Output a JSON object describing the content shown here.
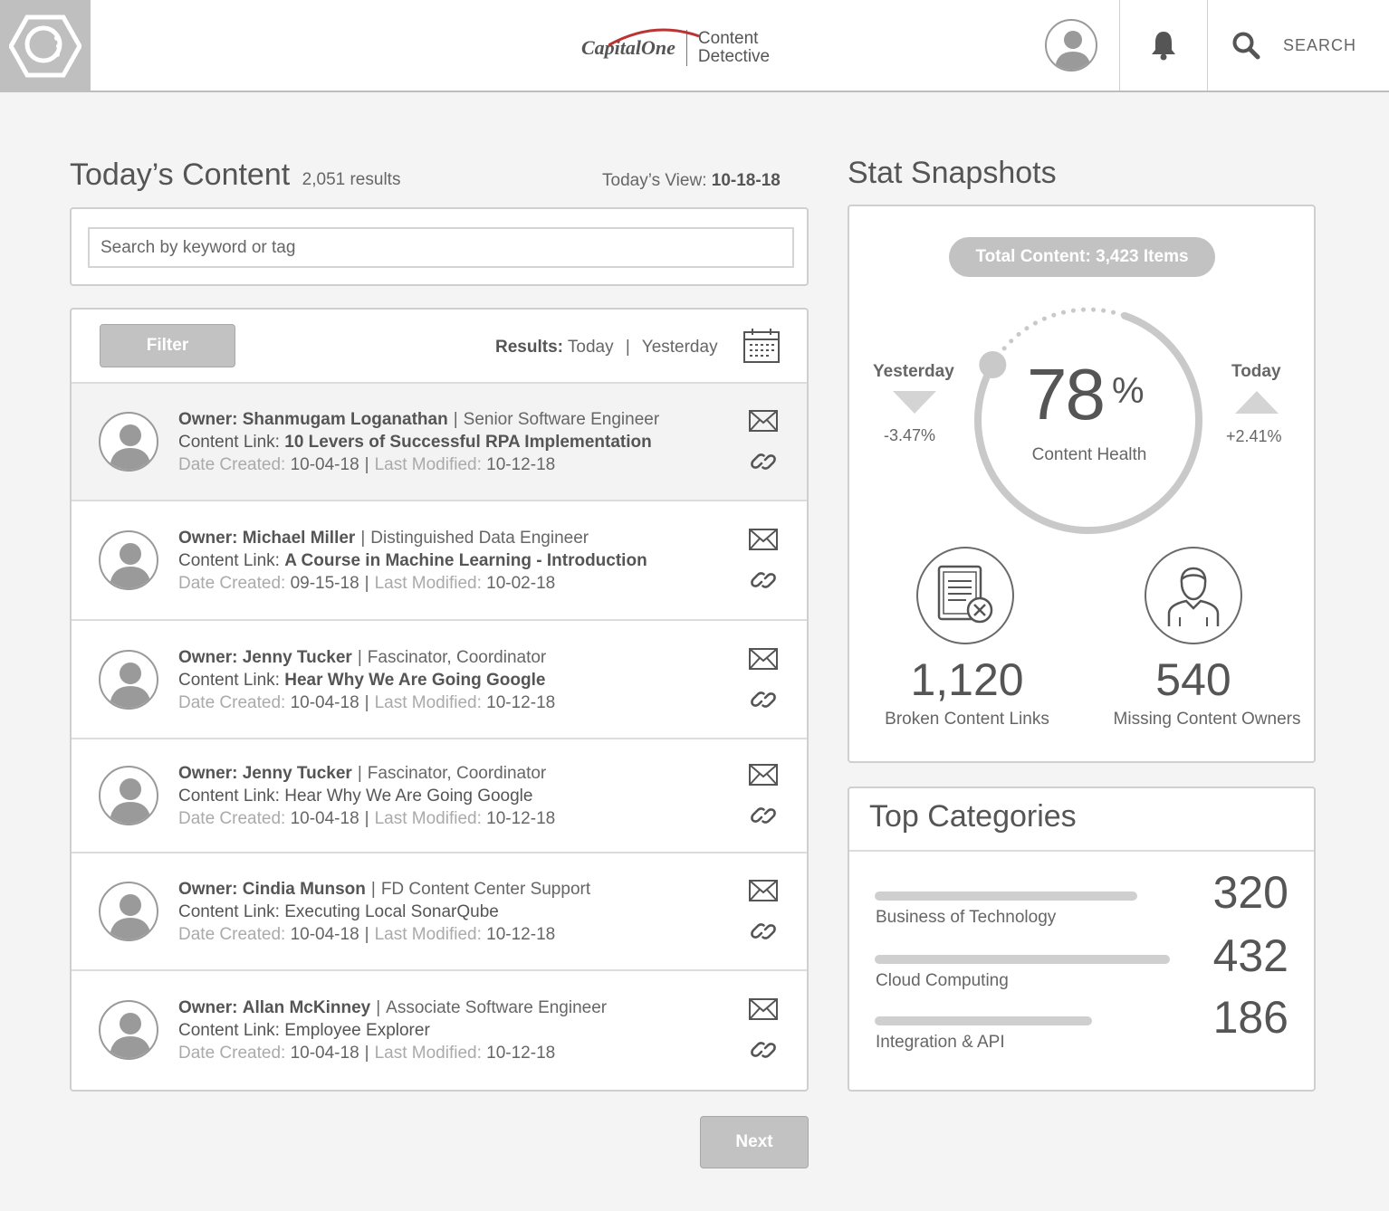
{
  "header": {
    "brand_logo": "CapitalOne",
    "product_line1": "Content",
    "product_line2": "Detective",
    "search_label": "SEARCH"
  },
  "content": {
    "title": "Today’s Content",
    "result_count": "2,051 results",
    "today_view_label": "Today’s View:",
    "today_view_date": "10-18-18",
    "search_placeholder": "Search by keyword or tag",
    "filter_label": "Filter",
    "results_label": "Results:",
    "results_today": "Today",
    "results_divider": "|",
    "results_yesterday": "Yesterday",
    "next_label": "Next",
    "field_labels": {
      "owner": "Owner:",
      "content_link": "Content Link:",
      "date_created": "Date Created:",
      "last_modified": "Last Modified:",
      "divider": "|"
    },
    "rows": [
      {
        "owner": "Shanmugam Loganathan",
        "role": "Senior Software Engineer",
        "content_link": "10 Levers of Successful RPA Implementation",
        "date_created": "10-04-18",
        "last_modified": "10-12-18"
      },
      {
        "owner": "Michael Miller",
        "role": "Distinguished Data Engineer",
        "content_link": "A Course in Machine Learning - Introduction",
        "date_created": "09-15-18",
        "last_modified": "10-02-18"
      },
      {
        "owner": "Jenny Tucker",
        "role": "Fascinator, Coordinator",
        "content_link": "Hear Why We Are Going Google",
        "date_created": "10-04-18",
        "last_modified": "10-12-18"
      },
      {
        "owner": "Jenny Tucker",
        "role": "Fascinator, Coordinator",
        "content_link": "Hear Why We Are Going Google",
        "date_created": "10-04-18",
        "last_modified": "10-12-18"
      },
      {
        "owner": "Cindia Munson",
        "role": "FD Content Center Support",
        "content_link": "Executing Local SonarQube",
        "date_created": "10-04-18",
        "last_modified": "10-12-18"
      },
      {
        "owner": "Allan McKinney",
        "role": "Associate Software Engineer",
        "content_link": "Employee Explorer",
        "date_created": "10-04-18",
        "last_modified": "10-12-18"
      }
    ]
  },
  "stats": {
    "title": "Stat Snapshots",
    "total_content": "Total Content: 3,423 Items",
    "health_value": "78",
    "health_percent_symbol": "%",
    "health_fraction": 0.78,
    "health_label": "Content Health",
    "yesterday_label": "Yesterday",
    "yesterday_change": "-3.47%",
    "today_label": "Today",
    "today_change": "+2.41%",
    "broken_links_value": "1,120",
    "broken_links_label": "Broken Content Links",
    "missing_owners_value": "540",
    "missing_owners_label": "Missing Content Owners"
  },
  "categories": {
    "title": "Top Categories",
    "items": [
      {
        "name": "Business of Technology",
        "value": "320"
      },
      {
        "name": "Cloud Computing",
        "value": "432"
      },
      {
        "name": "Integration & API",
        "value": "186"
      }
    ]
  },
  "colors": {
    "page_bg": "#f4f4f4",
    "accent_gray": "#c2c2c2",
    "text": "#555555"
  },
  "icons": [
    "hexagon-logo-icon",
    "user-avatar-icon",
    "bell-icon",
    "search-icon",
    "calendar-icon",
    "mail-icon",
    "link-icon",
    "document-error-icon",
    "person-icon"
  ]
}
